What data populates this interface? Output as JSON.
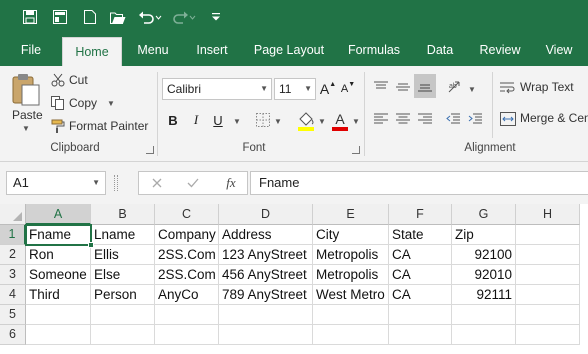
{
  "colors": {
    "accent": "#217346",
    "ribbon_bg": "#f3f3f3",
    "highlight_fill": "#ffff00",
    "font_color_bar": "#e00000"
  },
  "qat": {
    "icons": [
      "save-icon",
      "new-icon",
      "open-icon",
      "undo-icon",
      "redo-icon",
      "customize-qat-icon"
    ]
  },
  "tabs": [
    {
      "label": "File"
    },
    {
      "label": "Home"
    },
    {
      "label": "Menu"
    },
    {
      "label": "Insert"
    },
    {
      "label": "Page Layout"
    },
    {
      "label": "Formulas"
    },
    {
      "label": "Data"
    },
    {
      "label": "Review"
    },
    {
      "label": "View"
    }
  ],
  "ribbon": {
    "clipboard": {
      "paste_label": "Paste",
      "cut_label": "Cut",
      "copy_label": "Copy",
      "format_painter_label": "Format Painter",
      "group_label": "Clipboard"
    },
    "font": {
      "font_name": "Calibri",
      "font_size": "11",
      "bold": "B",
      "italic": "I",
      "underline": "U",
      "font_color_glyph": "A",
      "grow_glyph": "A",
      "shrink_glyph": "A",
      "group_label": "Font"
    },
    "alignment": {
      "wrap_text_label": "Wrap Text",
      "merge_label": "Merge & Center",
      "group_label": "Alignment"
    }
  },
  "formula_bar": {
    "name_box": "A1",
    "fx_label": "fx",
    "formula_value": "Fname"
  },
  "sheet": {
    "columns": [
      "A",
      "B",
      "C",
      "D",
      "E",
      "F",
      "G",
      "H"
    ],
    "row_numbers": [
      "1",
      "2",
      "3",
      "4",
      "5",
      "6"
    ],
    "rows": [
      [
        "Fname",
        "Lname",
        "Company",
        "Address",
        "City",
        "State",
        "Zip",
        ""
      ],
      [
        "Ron",
        "Ellis",
        "2SS.Com",
        "123 AnyStreet",
        "Metropolis",
        "CA",
        "92100",
        ""
      ],
      [
        "Someone",
        "Else",
        "2SS.Com",
        "456 AnyStreet",
        "Metropolis",
        "CA",
        "92010",
        ""
      ],
      [
        "Third",
        "Person",
        "AnyCo",
        "789 AnyStreet",
        "West Metro",
        "CA",
        "92111",
        ""
      ],
      [
        "",
        "",
        "",
        "",
        "",
        "",
        "",
        ""
      ],
      [
        "",
        "",
        "",
        "",
        "",
        "",
        "",
        ""
      ]
    ],
    "active_cell": "A1"
  }
}
